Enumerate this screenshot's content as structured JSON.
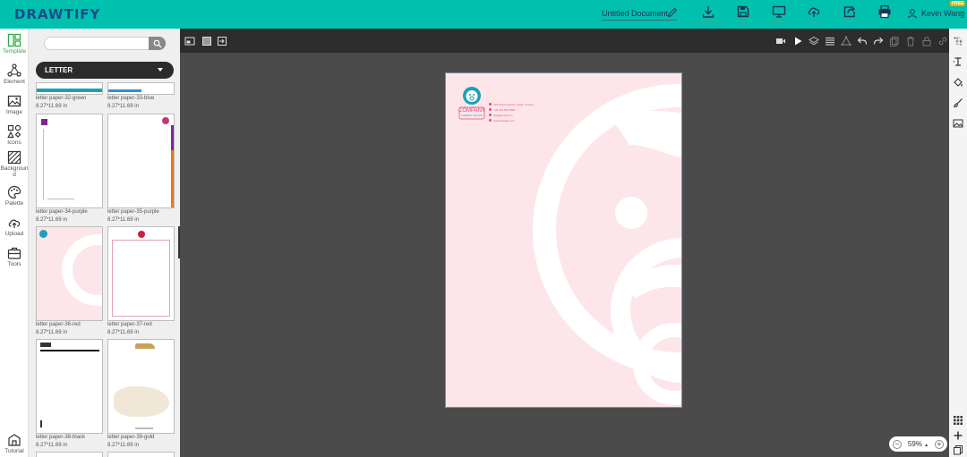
{
  "app": {
    "logo": "DRAWTIFY",
    "document_title": "Untitled Document",
    "user_name": "Kevin Wang",
    "free_badge": "FREE"
  },
  "top_actions": [
    {
      "icon": "download-icon",
      "label": "Save/Download"
    },
    {
      "icon": "save-icon",
      "label": "Save"
    },
    {
      "icon": "present-icon",
      "label": "Present"
    },
    {
      "icon": "cloud-icon",
      "label": "Cloud"
    },
    {
      "icon": "share-icon",
      "label": "Share"
    },
    {
      "icon": "print-icon",
      "label": ""
    }
  ],
  "rail": [
    {
      "icon": "template-icon",
      "label": "Template",
      "active": true
    },
    {
      "icon": "element-icon",
      "label": "Element"
    },
    {
      "icon": "image-icon",
      "label": "Image"
    },
    {
      "icon": "icons-icon",
      "label": "Icons"
    },
    {
      "icon": "background-icon",
      "label": "Background"
    },
    {
      "icon": "palette-icon",
      "label": "Palette"
    },
    {
      "icon": "upload-icon",
      "label": "Upload"
    },
    {
      "icon": "tools-icon",
      "label": "Tools"
    },
    {
      "icon": "tutorial-icon",
      "label": "Tutorial"
    }
  ],
  "panel": {
    "search_placeholder": "",
    "category": "LETTER",
    "templates": [
      {
        "name": "letter paper-32-green",
        "size": "8.27*11.69 in",
        "accent": "#1aa0b8"
      },
      {
        "name": "letter paper-33-blue",
        "size": "8.27*11.69 in",
        "accent": "#2f8fd6"
      },
      {
        "name": "letter paper-34-purple",
        "size": "8.27*11.69 in",
        "accent": "#7a2a8f"
      },
      {
        "name": "letter paper-35-purple",
        "size": "8.27*11.69 in",
        "accent": "#7a2a8f"
      },
      {
        "name": "letter paper-36-red",
        "size": "8.27*11.69 in",
        "accent": "#fde6ea"
      },
      {
        "name": "letter paper-37-red",
        "size": "8.27*11.69 in",
        "accent": "#d21f3c"
      },
      {
        "name": "letter paper-38-black",
        "size": "8.27*11.69 in",
        "accent": "#111111"
      },
      {
        "name": "letter paper-39-gold",
        "size": "8.27*11.69 in",
        "accent": "#c9a15b"
      }
    ]
  },
  "letterhead": {
    "company": "COMPANY",
    "tagline": "COMPANY SLOGAN",
    "contact_lines": [
      "123 Street Avenue, State, Country",
      "+00 123 456 7890",
      "info@email.com",
      "www.website.com"
    ],
    "brand_color": "#1aa0b8",
    "accent_color": "#e64b7b"
  },
  "zoom": {
    "value": "59%",
    "minus": "−",
    "plus": "+"
  },
  "colors": {
    "topbar": "#00c1ae",
    "logo": "#1f4b8c",
    "canvas": "#4b4b4b",
    "toolbar": "#2d2d2d",
    "page": "#fde6ea"
  }
}
